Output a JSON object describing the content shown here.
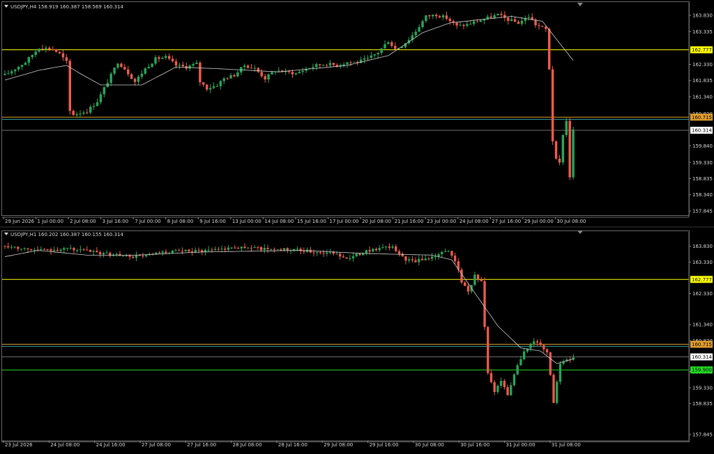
{
  "colors": {
    "background": "#000000",
    "bull": "#26a65b",
    "bear": "#f05b4b",
    "ma": "#cfcfcf",
    "yellow": "#ffff00",
    "orange": "#e39e2c",
    "green": "#22dd22",
    "teal": "#33a3a6",
    "price_line": "#6f6f6f",
    "text": "#d8d8d8"
  },
  "chart_data": [
    {
      "type": "candlestick",
      "symbol": "USDJPY,H4",
      "title": "USDJPY,H4  158.919 160.387 158.569 160.314",
      "ylim": [
        157.78,
        164.13
      ],
      "y_ticks": [
        "163.830",
        "163.335",
        "162.330",
        "161.835",
        "161.340",
        "160.820",
        "159.840",
        "159.330",
        "158.835",
        "158.340",
        "157.845"
      ],
      "x_ticks": [
        "29 Jun 2026",
        "1 Jul 00:00",
        "2 Jul 08:00",
        "3 Jul 16:00",
        "7 Jul 00:00",
        "8 Jul 08:00",
        "9 Jul 16:00",
        "13 Jul 00:00",
        "14 Jul 08:00",
        "15 Jul 16:00",
        "17 Jul 00:00",
        "20 Jul 08:00",
        "21 Jul 16:00",
        "23 Jul 00:00",
        "24 Jul 08:00",
        "27 Jul 16:00",
        "29 Jul 00:00",
        "30 Jul 08:00"
      ],
      "levels": [
        {
          "value": 162.777,
          "color": "#ffff00",
          "label": "162.777"
        },
        {
          "value": 160.715,
          "color": "#e39e2c",
          "label": "160.715"
        },
        {
          "value": 160.65,
          "color": "#33a3a6",
          "label": ""
        },
        {
          "value": 160.314,
          "color": "#6f6f6f",
          "label": "160.314"
        }
      ],
      "current": "160.314",
      "anchors": [
        [
          0,
          162.0
        ],
        [
          6,
          162.4
        ],
        [
          10,
          162.85
        ],
        [
          14,
          162.8
        ],
        [
          16,
          162.65
        ],
        [
          18,
          162.4
        ],
        [
          19,
          160.9
        ],
        [
          20,
          160.8
        ],
        [
          24,
          160.9
        ],
        [
          27,
          161.2
        ],
        [
          30,
          161.8
        ],
        [
          33,
          162.4
        ],
        [
          35,
          162.2
        ],
        [
          38,
          161.8
        ],
        [
          41,
          162.2
        ],
        [
          44,
          162.5
        ],
        [
          47,
          162.55
        ],
        [
          50,
          162.3
        ],
        [
          53,
          162.25
        ],
        [
          56,
          162.35
        ],
        [
          57,
          161.8
        ],
        [
          59,
          161.6
        ],
        [
          62,
          161.7
        ],
        [
          64,
          161.9
        ],
        [
          67,
          162.0
        ],
        [
          70,
          162.3
        ],
        [
          73,
          162.2
        ],
        [
          76,
          161.9
        ],
        [
          79,
          162.15
        ],
        [
          82,
          162.1
        ],
        [
          85,
          162.05
        ],
        [
          88,
          162.2
        ],
        [
          91,
          162.3
        ],
        [
          94,
          162.35
        ],
        [
          97,
          162.3
        ],
        [
          100,
          162.4
        ],
        [
          103,
          162.4
        ],
        [
          106,
          162.5
        ],
        [
          109,
          162.7
        ],
        [
          112,
          163.05
        ],
        [
          114,
          162.8
        ],
        [
          116,
          162.9
        ],
        [
          118,
          163.1
        ],
        [
          120,
          163.35
        ],
        [
          123,
          163.8
        ],
        [
          126,
          163.85
        ],
        [
          129,
          163.75
        ],
        [
          132,
          163.5
        ],
        [
          135,
          163.55
        ],
        [
          138,
          163.65
        ],
        [
          141,
          163.75
        ],
        [
          144,
          163.85
        ],
        [
          147,
          163.7
        ],
        [
          150,
          163.6
        ],
        [
          153,
          163.8
        ],
        [
          155,
          163.55
        ],
        [
          158,
          163.4
        ],
        [
          159,
          162.2
        ],
        [
          160,
          160.0
        ],
        [
          161,
          159.4
        ],
        [
          162,
          159.3
        ],
        [
          163,
          160.2
        ],
        [
          164,
          160.6
        ],
        [
          165,
          158.9
        ],
        [
          166,
          160.31
        ]
      ],
      "candles_count": 167,
      "ma_start": [
        [
          0,
          161.85
        ],
        [
          10,
          162.15
        ],
        [
          18,
          162.3
        ],
        [
          22,
          162.05
        ],
        [
          28,
          161.7
        ],
        [
          40,
          161.7
        ],
        [
          50,
          162.25
        ],
        [
          62,
          162.2
        ],
        [
          80,
          162.1
        ],
        [
          100,
          162.3
        ],
        [
          112,
          162.6
        ],
        [
          122,
          163.3
        ],
        [
          130,
          163.6
        ],
        [
          148,
          163.8
        ],
        [
          157,
          163.65
        ],
        [
          163,
          162.85
        ],
        [
          166,
          162.45
        ]
      ]
    },
    {
      "type": "candlestick",
      "symbol": "USDJPY,H1",
      "title": "USDJPY,H1  160.202 160.387 160.155 160.314",
      "ylim": [
        157.78,
        164.2
      ],
      "y_ticks": [
        "163.830",
        "163.330",
        "162.330",
        "161.340",
        "160.820",
        "159.840",
        "159.330",
        "158.835",
        "157.845"
      ],
      "x_ticks": [
        "23 Jul 2026",
        "24 Jul 08:00",
        "24 Jul 16:00",
        "27 Jul 08:00",
        "27 Jul 16:00",
        "28 Jul 08:00",
        "28 Jul 16:00",
        "29 Jul 08:00",
        "29 Jul 16:00",
        "30 Jul 08:00",
        "30 Jul 16:00",
        "31 Jul 00:00",
        "31 Jul 08:00"
      ],
      "levels": [
        {
          "value": 162.777,
          "color": "#ffff00",
          "label": "162.777"
        },
        {
          "value": 160.715,
          "color": "#e39e2c",
          "label": "160.715"
        },
        {
          "value": 160.65,
          "color": "#33a3a6",
          "label": ""
        },
        {
          "value": 160.314,
          "color": "#6f6f6f",
          "label": "160.314"
        },
        {
          "value": 159.9,
          "color": "#22dd22",
          "label": "159.900"
        }
      ],
      "current": "160.314",
      "anchors": [
        [
          0,
          163.85
        ],
        [
          10,
          163.7
        ],
        [
          20,
          163.75
        ],
        [
          30,
          163.6
        ],
        [
          38,
          163.5
        ],
        [
          44,
          163.55
        ],
        [
          50,
          163.65
        ],
        [
          60,
          163.7
        ],
        [
          70,
          163.8
        ],
        [
          80,
          163.75
        ],
        [
          90,
          163.7
        ],
        [
          100,
          163.6
        ],
        [
          105,
          163.45
        ],
        [
          110,
          163.7
        ],
        [
          118,
          163.8
        ],
        [
          122,
          163.4
        ],
        [
          125,
          163.35
        ],
        [
          130,
          163.5
        ],
        [
          135,
          163.7
        ],
        [
          137,
          163.4
        ],
        [
          139,
          162.7
        ],
        [
          141,
          162.4
        ],
        [
          143,
          162.9
        ],
        [
          145,
          162.7
        ],
        [
          147,
          159.8
        ],
        [
          149,
          159.2
        ],
        [
          151,
          159.6
        ],
        [
          153,
          159.1
        ],
        [
          155,
          159.8
        ],
        [
          158,
          160.5
        ],
        [
          161,
          160.8
        ],
        [
          163,
          160.7
        ],
        [
          165,
          160.5
        ],
        [
          167,
          158.9
        ],
        [
          169,
          160.1
        ],
        [
          171,
          160.2
        ],
        [
          173,
          160.31
        ]
      ],
      "candles_count": 174,
      "ma_start": [
        [
          0,
          163.5
        ],
        [
          10,
          163.7
        ],
        [
          25,
          163.55
        ],
        [
          40,
          163.55
        ],
        [
          60,
          163.65
        ],
        [
          90,
          163.7
        ],
        [
          110,
          163.6
        ],
        [
          130,
          163.55
        ],
        [
          136,
          163.4
        ],
        [
          142,
          162.5
        ],
        [
          150,
          161.3
        ],
        [
          157,
          160.6
        ],
        [
          163,
          160.5
        ],
        [
          168,
          160.1
        ],
        [
          173,
          160.25
        ]
      ]
    }
  ]
}
